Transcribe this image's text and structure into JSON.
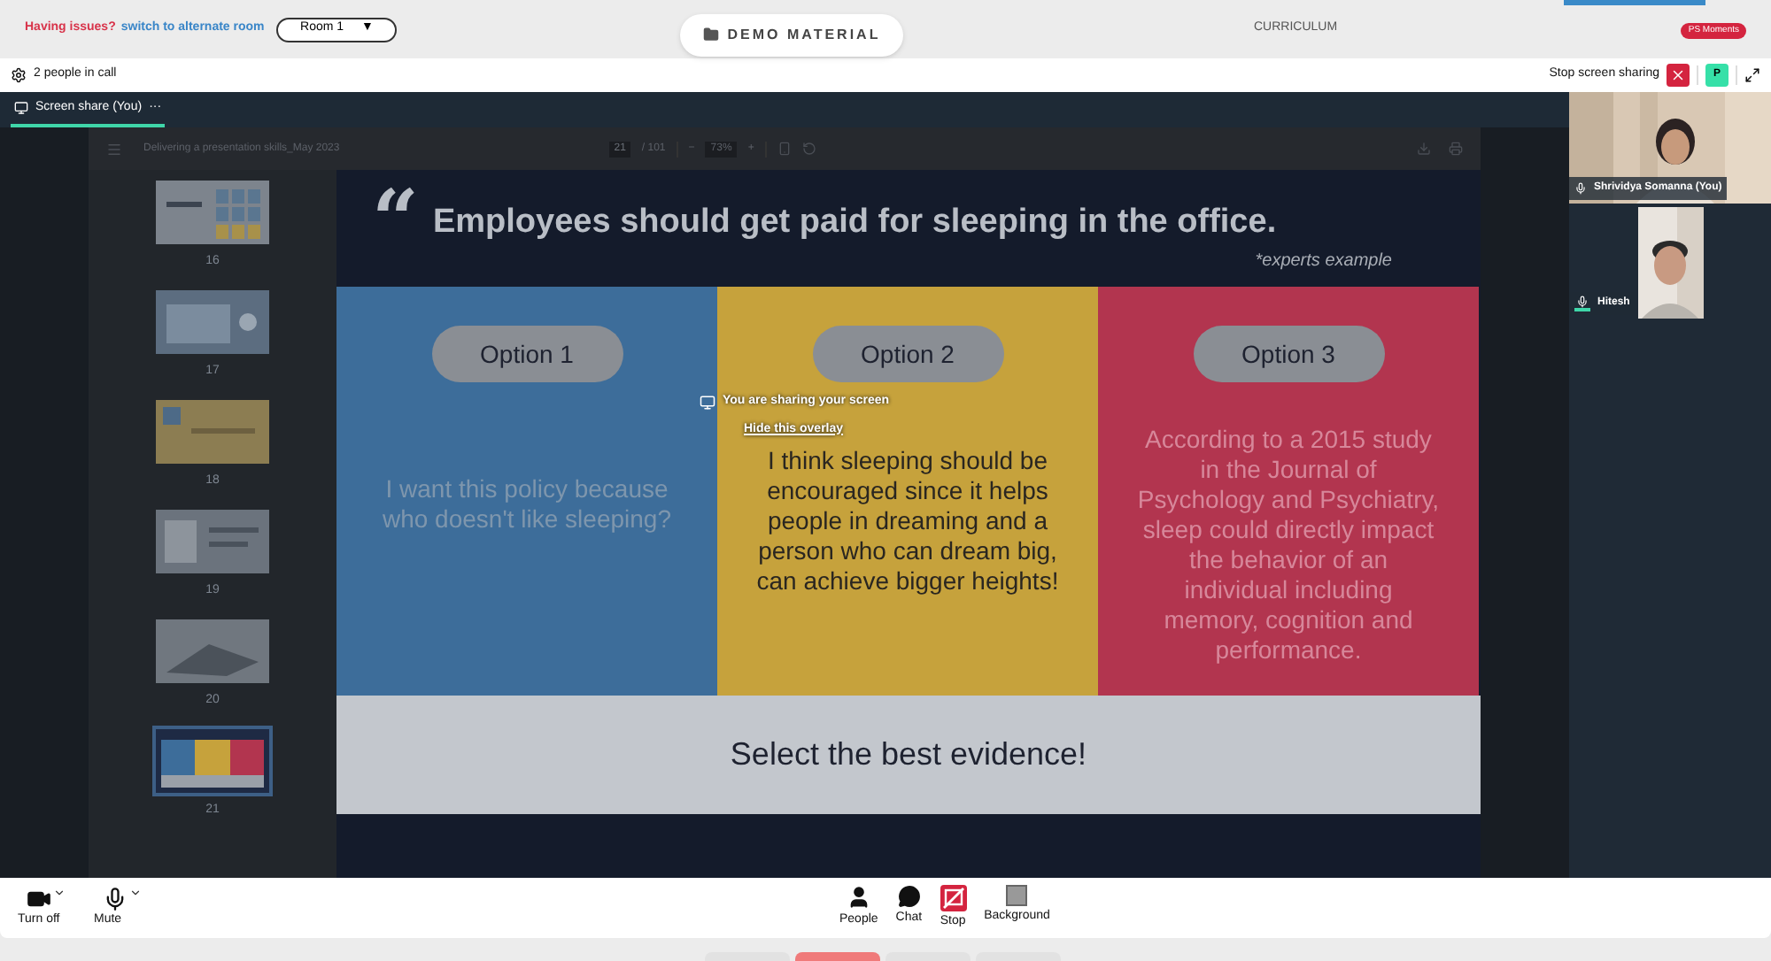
{
  "top_bar": {
    "issue_text": "Having issues?",
    "switch_link": "switch to alternate room",
    "room_select": "Room 1",
    "room_caret": "▼",
    "demo_button": "DEMO MATERIAL",
    "curriculum": "CURRICULUM",
    "moments_badge": "PS Moments"
  },
  "call_bar": {
    "people_count": "2 people in call",
    "stop_sharing": "Stop screen sharing",
    "avatar_letter": "P"
  },
  "share_tab": {
    "label": "Screen share (You)",
    "menu": "···",
    "selected": true
  },
  "pdf_viewer": {
    "title": "Delivering a presentation skills_May 2023",
    "page": "21",
    "page_total": "/ 101",
    "zoom_out": "−",
    "zoom": "73%",
    "zoom_in": "+",
    "thumbnails": [
      {
        "page": "16",
        "kind": "grid",
        "selected": false
      },
      {
        "page": "17",
        "kind": "screen",
        "selected": false
      },
      {
        "page": "18",
        "kind": "yellow",
        "selected": false
      },
      {
        "page": "19",
        "kind": "device",
        "selected": false
      },
      {
        "page": "20",
        "selected": false
      },
      {
        "page": "21",
        "kind": "options",
        "selected": true
      }
    ]
  },
  "slide": {
    "quote_mark": "“",
    "heading": "Employees should get paid for sleeping in the office.",
    "note": "*experts example",
    "options": [
      {
        "label": "Option 1",
        "text": "I want this policy because who doesn't like sleeping?",
        "color": "#3d6d9a"
      },
      {
        "label": "Option 2",
        "text": "I think sleeping should be encouraged since it helps people in dreaming and a person who can dream big, can achieve bigger heights!",
        "color": "#c6a23c"
      },
      {
        "label": "Option 3",
        "text": "According to a 2015 study in the Journal of Psychology and Psychiatry, sleep could directly impact the behavior of an individual including memory, cognition and performance.",
        "color": "#b2354f"
      }
    ],
    "footer": "Select the best evidence!"
  },
  "overlay": {
    "message": "You are sharing your screen",
    "hide_link": "Hide this overlay"
  },
  "participants": [
    {
      "name": "Shrividya Somanna (You)",
      "speaking": false,
      "kind": "full"
    },
    {
      "name": "Hitesh",
      "speaking": true,
      "kind": "narrow"
    }
  ],
  "controls": {
    "left": [
      {
        "label": "Turn off",
        "kind": "camera"
      },
      {
        "label": "Mute",
        "kind": "mic"
      }
    ],
    "center": [
      {
        "label": "People",
        "kind": "people"
      },
      {
        "label": "Chat",
        "kind": "chat"
      },
      {
        "label": "Stop",
        "kind": "stop"
      },
      {
        "label": "Background",
        "kind": "background"
      }
    ]
  },
  "bottom_tabs": [
    {
      "selected": false
    },
    {
      "selected": true
    },
    {
      "selected": false
    },
    {
      "selected": false
    }
  ]
}
